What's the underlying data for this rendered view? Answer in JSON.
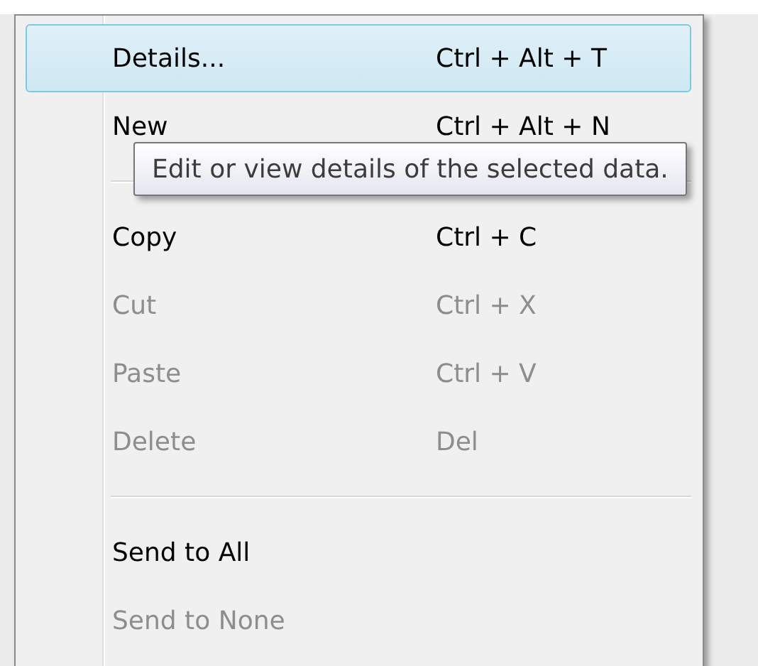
{
  "menu": {
    "items": [
      {
        "kind": "item",
        "label": "Details...",
        "shortcut": "Ctrl + Alt + T",
        "selected": true,
        "disabled": false
      },
      {
        "kind": "item",
        "label": "New",
        "shortcut": "Ctrl + Alt + N",
        "selected": false,
        "disabled": false
      },
      {
        "kind": "separator"
      },
      {
        "kind": "item",
        "label": "Copy",
        "shortcut": "Ctrl + C",
        "selected": false,
        "disabled": false
      },
      {
        "kind": "item",
        "label": "Cut",
        "shortcut": "Ctrl + X",
        "selected": false,
        "disabled": true
      },
      {
        "kind": "item",
        "label": "Paste",
        "shortcut": "Ctrl + V",
        "selected": false,
        "disabled": true
      },
      {
        "kind": "item",
        "label": "Delete",
        "shortcut": "Del",
        "selected": false,
        "disabled": true
      },
      {
        "kind": "separator"
      },
      {
        "kind": "item",
        "label": "Send to All",
        "selected": false,
        "disabled": false
      },
      {
        "kind": "item",
        "label": "Send to None",
        "selected": false,
        "disabled": true
      }
    ]
  },
  "tooltip": {
    "text": "Edit or view details of the selected data."
  }
}
